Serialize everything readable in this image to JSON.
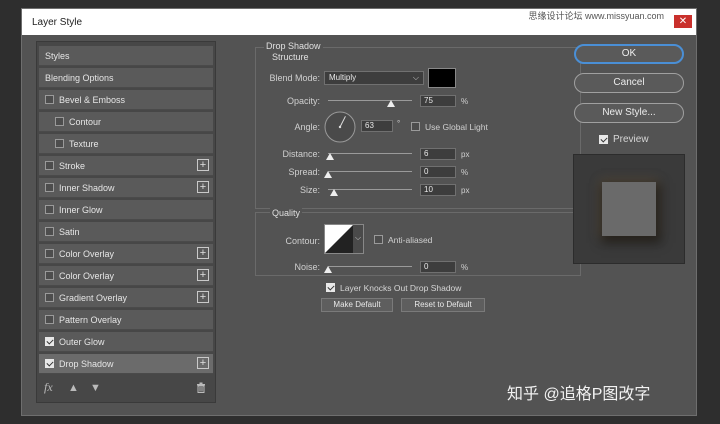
{
  "window": {
    "title": "Layer Style",
    "watermark": "思缘设计论坛  www.missyuan.com",
    "close": "✕"
  },
  "sidebar": {
    "items": [
      {
        "label": "Styles",
        "checkbox": false,
        "checked": false,
        "plus": false,
        "indent": 0,
        "selected": false
      },
      {
        "label": "Blending Options",
        "checkbox": false,
        "checked": false,
        "plus": false,
        "indent": 0,
        "selected": false
      },
      {
        "label": "Bevel & Emboss",
        "checkbox": true,
        "checked": false,
        "plus": false,
        "indent": 0,
        "selected": false
      },
      {
        "label": "Contour",
        "checkbox": true,
        "checked": false,
        "plus": false,
        "indent": 1,
        "selected": false
      },
      {
        "label": "Texture",
        "checkbox": true,
        "checked": false,
        "plus": false,
        "indent": 1,
        "selected": false
      },
      {
        "label": "Stroke",
        "checkbox": true,
        "checked": false,
        "plus": true,
        "indent": 0,
        "selected": false
      },
      {
        "label": "Inner Shadow",
        "checkbox": true,
        "checked": false,
        "plus": true,
        "indent": 0,
        "selected": false
      },
      {
        "label": "Inner Glow",
        "checkbox": true,
        "checked": false,
        "plus": false,
        "indent": 0,
        "selected": false
      },
      {
        "label": "Satin",
        "checkbox": true,
        "checked": false,
        "plus": false,
        "indent": 0,
        "selected": false
      },
      {
        "label": "Color Overlay",
        "checkbox": true,
        "checked": false,
        "plus": true,
        "indent": 0,
        "selected": false
      },
      {
        "label": "Color Overlay",
        "checkbox": true,
        "checked": false,
        "plus": true,
        "indent": 0,
        "selected": false
      },
      {
        "label": "Gradient Overlay",
        "checkbox": true,
        "checked": false,
        "plus": true,
        "indent": 0,
        "selected": false
      },
      {
        "label": "Pattern Overlay",
        "checkbox": true,
        "checked": false,
        "plus": false,
        "indent": 0,
        "selected": false
      },
      {
        "label": "Outer Glow",
        "checkbox": true,
        "checked": true,
        "plus": false,
        "indent": 0,
        "selected": false
      },
      {
        "label": "Drop Shadow",
        "checkbox": true,
        "checked": true,
        "plus": true,
        "indent": 0,
        "selected": true
      }
    ],
    "fx_label": "fx"
  },
  "drop_shadow": {
    "section_title": "Drop Shadow",
    "structure_title": "Structure",
    "blend_mode_label": "Blend Mode:",
    "blend_mode_value": "Multiply",
    "shadow_color": "#000000",
    "opacity_label": "Opacity:",
    "opacity_value": "75",
    "opacity_unit": "%",
    "opacity_fraction": 0.75,
    "angle_label": "Angle:",
    "angle_value": "63",
    "angle_unit": "°",
    "use_global_light_label": "Use Global Light",
    "use_global_light_checked": false,
    "distance_label": "Distance:",
    "distance_value": "6",
    "distance_unit": "px",
    "distance_fraction": 0.02,
    "spread_label": "Spread:",
    "spread_value": "0",
    "spread_unit": "%",
    "spread_fraction": 0,
    "size_label": "Size:",
    "size_value": "10",
    "size_unit": "px",
    "size_fraction": 0.07
  },
  "quality": {
    "title": "Quality",
    "contour_label": "Contour:",
    "anti_aliased_label": "Anti-aliased",
    "anti_aliased_checked": false,
    "noise_label": "Noise:",
    "noise_value": "0",
    "noise_unit": "%",
    "noise_fraction": 0,
    "knockout_label": "Layer Knocks Out Drop Shadow",
    "knockout_checked": true,
    "make_default_label": "Make Default",
    "reset_default_label": "Reset to Default"
  },
  "actions": {
    "ok_label": "OK",
    "cancel_label": "Cancel",
    "new_style_label": "New Style...",
    "preview_label": "Preview",
    "preview_checked": true
  },
  "overlay_text": "知乎 @追格P图改字",
  "colors": {
    "accent": "#4a8fd6",
    "dialog_bg": "#535353"
  }
}
